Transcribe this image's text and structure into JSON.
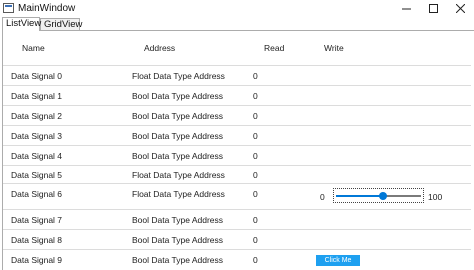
{
  "window": {
    "title": "MainWindow"
  },
  "tabs": [
    {
      "label": "ListView"
    },
    {
      "label": "GridView"
    }
  ],
  "columns": {
    "name": "Name",
    "address": "Address",
    "read": "Read",
    "write": "Write"
  },
  "rows": [
    {
      "name": "Data Signal 0",
      "address": "Float Data Type Address",
      "read": "0"
    },
    {
      "name": "Data Signal 1",
      "address": "Bool Data Type Address",
      "read": "0"
    },
    {
      "name": "Data Signal 2",
      "address": "Bool Data Type Address",
      "read": "0"
    },
    {
      "name": "Data Signal 3",
      "address": "Bool Data Type Address",
      "read": "0"
    },
    {
      "name": "Data Signal 4",
      "address": "Bool Data Type Address",
      "read": "0"
    },
    {
      "name": "Data Signal 5",
      "address": "Float Data Type Address",
      "read": "0"
    },
    {
      "name": "Data Signal 6",
      "address": "Float Data Type Address",
      "read": "0"
    },
    {
      "name": "Data Signal 7",
      "address": "Bool Data Type Address",
      "read": "0"
    },
    {
      "name": "Data Signal 8",
      "address": "Bool Data Type Address",
      "read": "0"
    },
    {
      "name": "Data Signal 9",
      "address": "Bool Data Type Address",
      "read": "0"
    }
  ],
  "slider": {
    "min": "0",
    "max": "100",
    "value": 55
  },
  "button": {
    "label": "Click Me"
  },
  "colors": {
    "accent": "#0078d7",
    "button": "#1ea0f0"
  }
}
